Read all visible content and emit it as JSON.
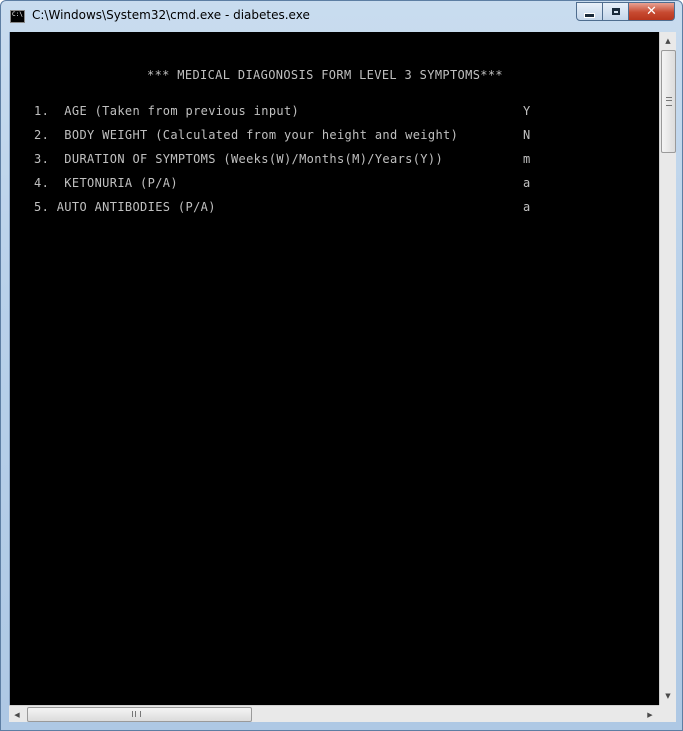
{
  "window": {
    "title": "C:\\Windows\\System32\\cmd.exe - diabetes.exe",
    "icon": "cmd-icon",
    "icon_text": "C:\\"
  },
  "controls": {
    "minimize_icon": "minimize-icon",
    "maximize_icon": "maximize-icon",
    "close_icon": "close-icon",
    "close_glyph": "✕"
  },
  "console": {
    "header": "*** MEDICAL DIAGONOSIS FORM LEVEL 3 SYMPTOMS***",
    "rows": [
      {
        "label": "1.  AGE (Taken from previous input)",
        "value": "Y"
      },
      {
        "label": "2.  BODY WEIGHT (Calculated from your height and weight)",
        "value": "N"
      },
      {
        "label": "3.  DURATION OF SYMPTOMS (Weeks(W)/Months(M)/Years(Y))",
        "value": "m"
      },
      {
        "label": "4.  KETONURIA (P/A)",
        "value": "a"
      },
      {
        "label": "5. AUTO ANTIBODIES (P/A)",
        "value": "a"
      }
    ],
    "background": "#000000",
    "text_color": "#c0c0c0"
  },
  "scrollbars": {
    "up_glyph": "▲",
    "down_glyph": "▼",
    "left_glyph": "◀",
    "right_glyph": "▶"
  }
}
